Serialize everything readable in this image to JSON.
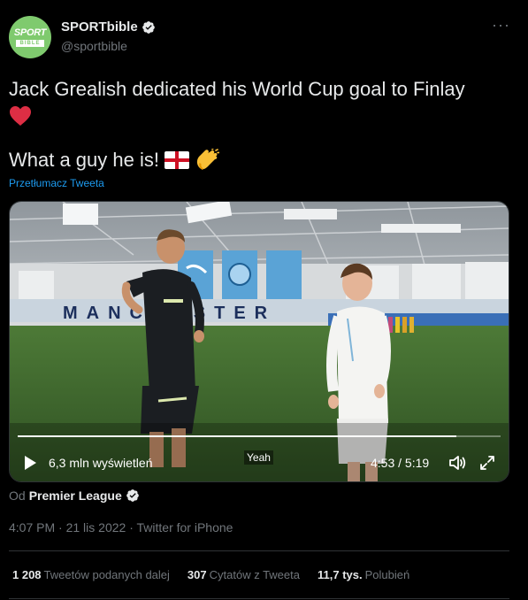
{
  "account": {
    "display_name": "SPORTbible",
    "handle": "@sportbible",
    "avatar_text_top": "SPORT",
    "avatar_text_bottom": "BIBLE"
  },
  "more_glyph": "···",
  "tweet": {
    "text_line1": "Jack Grealish dedicated his World Cup goal to Finlay",
    "text_line2": "What a guy he is!",
    "translate_label": "Przetłumacz Tweeta"
  },
  "video": {
    "progress": 0.9089,
    "views_label": "6,3 mln wyświetleń",
    "caption": "Yeah",
    "time_label": "4:53 / 5:19",
    "banner_text": "MANCHESTER"
  },
  "source": {
    "prefix": "Od",
    "name": "Premier League"
  },
  "meta": {
    "time": "4:07 PM",
    "sep1": "·",
    "date": "21 lis 2022",
    "sep2": "·",
    "client": "Twitter for iPhone"
  },
  "stats": [
    {
      "count": "1 208",
      "label": "Tweetów podanych dalej"
    },
    {
      "count": "307",
      "label": "Cytatów z Tweeta"
    },
    {
      "count": "11,7 tys.",
      "label": "Polubień"
    }
  ],
  "colors": {
    "background": "#000000",
    "accent": "#1d9bf0",
    "secondary_text": "#71767b",
    "avatar_bg": "#7fca6e",
    "heart": "#f91880"
  }
}
